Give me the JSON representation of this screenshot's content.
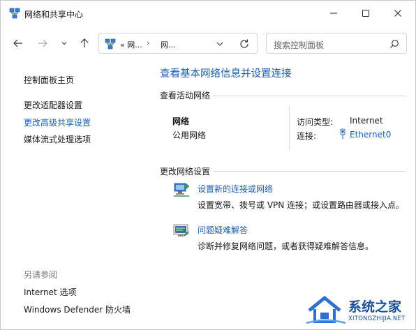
{
  "window": {
    "title": "网络和共享中心",
    "controls": {
      "minimize": "minimize-icon",
      "maximize": "maximize-icon",
      "close": "close-icon"
    }
  },
  "nav": {
    "address_prefix": "«",
    "address_crumb_1": "网...",
    "address_separator": "›",
    "address_crumb_2": "网...",
    "search_placeholder": "搜索控制面板"
  },
  "sidebar": {
    "items": [
      {
        "label": "控制面板主页"
      },
      {
        "label": "更改适配器设置"
      },
      {
        "label": "更改高级共享设置"
      },
      {
        "label": "媒体流式处理选项"
      }
    ],
    "see_also_title": "另请参阅",
    "see_also": [
      {
        "label": "Internet 选项"
      },
      {
        "label": "Windows Defender 防火墙"
      }
    ]
  },
  "main": {
    "title": "查看基本网络信息并设置连接",
    "active_networks_label": "查看活动网络",
    "network": {
      "name": "网络",
      "category": "公用网络",
      "access_type_label": "访问类型:",
      "access_type_value": "Internet",
      "connections_label": "连接:",
      "connections_value": "Ethernet0"
    },
    "change_settings_label": "更改网络设置",
    "tasks": [
      {
        "link": "设置新的连接或网络",
        "desc": "设置宽带、拨号或 VPN 连接；或设置路由器或接入点。",
        "icon": "new-connection-icon"
      },
      {
        "link": "问题疑难解答",
        "desc": "诊断并修复网络问题，或者获得疑难解答信息。",
        "icon": "troubleshoot-icon"
      }
    ]
  },
  "watermark": {
    "title": "系统之家",
    "url": "XITONGZHIJIA.NET"
  },
  "colors": {
    "link": "#1a5fb4",
    "text": "#1a1a1a",
    "muted": "#777777"
  }
}
